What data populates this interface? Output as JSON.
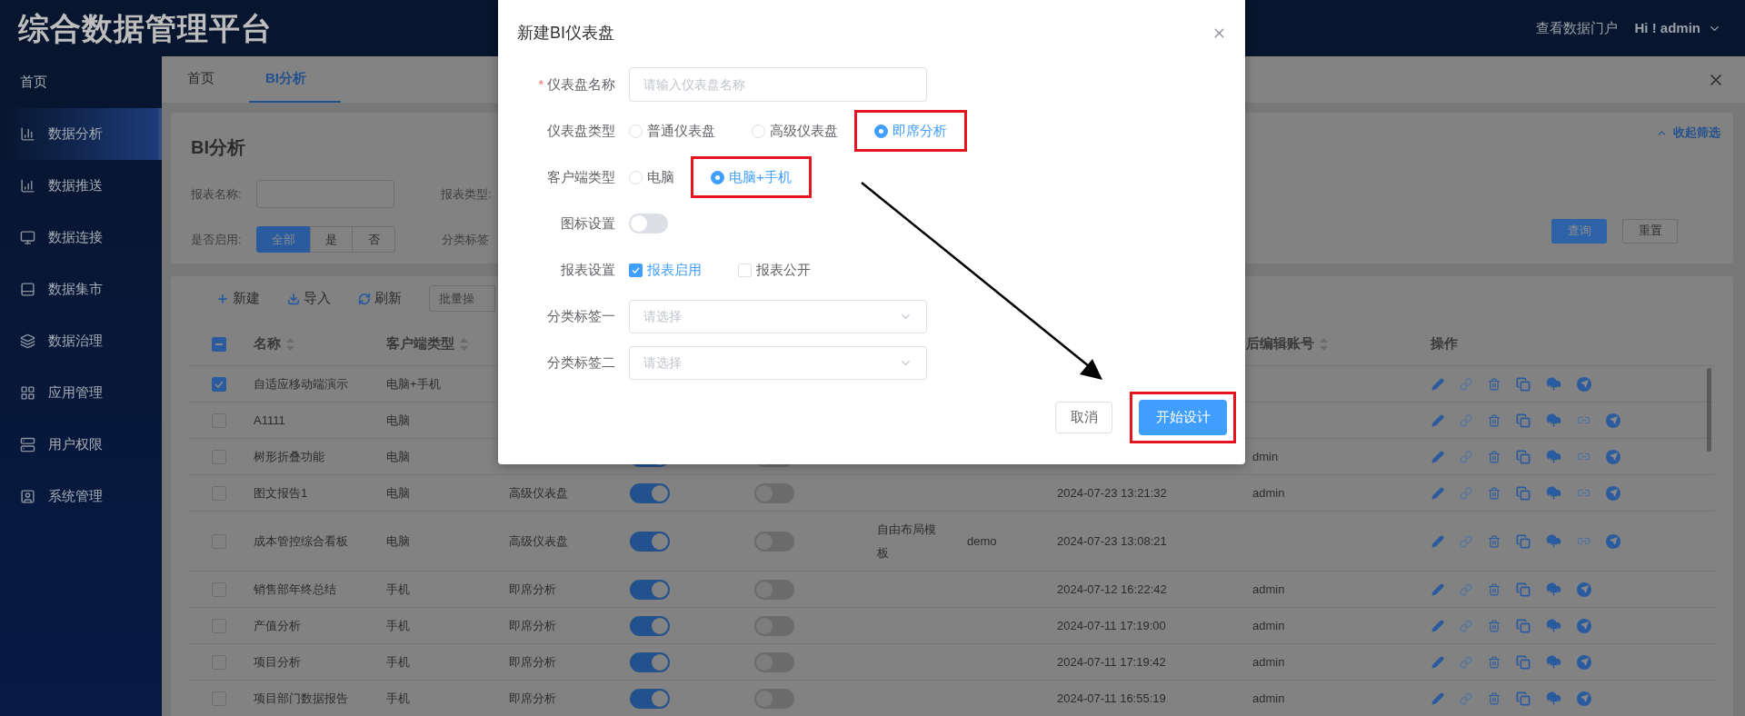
{
  "header": {
    "title": "综合数据管理平台",
    "portal_link": "查看数据门户",
    "user": "Hi ! admin"
  },
  "sidebar": {
    "items": [
      {
        "label": "首页",
        "selected": false
      },
      {
        "label": "数据分析",
        "selected": true
      },
      {
        "label": "数据推送",
        "selected": false
      },
      {
        "label": "数据连接",
        "selected": false
      },
      {
        "label": "数据集市",
        "selected": false
      },
      {
        "label": "数据治理",
        "selected": false
      },
      {
        "label": "应用管理",
        "selected": false
      },
      {
        "label": "用户权限",
        "selected": false
      },
      {
        "label": "系统管理",
        "selected": false
      }
    ]
  },
  "tabs": [
    {
      "label": "首页",
      "selected": false
    },
    {
      "label": "BI分析",
      "selected": true
    }
  ],
  "filter": {
    "title": "BI分析",
    "toggle": "收起筛选",
    "name_label": "报表名称:",
    "type_label": "报表类型:",
    "enabled_label": "是否启用:",
    "enabled_options": [
      {
        "label": "全部",
        "selected": true
      },
      {
        "label": "是",
        "selected": false
      },
      {
        "label": "否",
        "selected": false
      }
    ],
    "tag_label": "分类标签",
    "buttons": [
      {
        "label": "查询",
        "kind": "primary"
      },
      {
        "label": "重置",
        "kind": "default"
      }
    ]
  },
  "table": {
    "toolbar": [
      {
        "label": "新建",
        "kind": "new"
      },
      {
        "label": "导入",
        "kind": "import"
      },
      {
        "label": "刷新",
        "kind": "refresh"
      },
      {
        "label": "批量操",
        "kind": "batch"
      }
    ],
    "header_partial": true,
    "columns": {
      "name": {
        "label": "名称",
        "sortable": true
      },
      "client_type": {
        "label": "客户端类型",
        "sortable": true
      },
      "last_editor": {
        "label": "后编辑账号",
        "sortable": true
      },
      "actions": {
        "label": "操作",
        "sortable": false
      }
    },
    "rows": [
      {
        "selected": true,
        "name": "自适应移动端演示",
        "client_type": "电脑+手机",
        "extra_action": false
      },
      {
        "selected": false,
        "name": "A1111",
        "client_type": "电脑",
        "extra_action": true
      },
      {
        "selected": false,
        "name": "树形折叠功能",
        "client_type": "电脑",
        "enabled": true,
        "public": false,
        "last_editor": "dmin",
        "extra_action": true
      },
      {
        "selected": false,
        "name": "图文报告1",
        "client_type": "电脑",
        "dashboard_type": "高级仪表盘",
        "enabled": true,
        "public": false,
        "updated": "2024-07-23 13:21:32",
        "last_editor": "admin",
        "extra_action": true
      },
      {
        "selected": false,
        "name": "成本管控综合看板",
        "client_type": "电脑",
        "dashboard_type": "高级仪表盘",
        "enabled": true,
        "public": false,
        "template": "自由布局模板",
        "creator": "demo",
        "updated": "2024-07-23 13:08:21",
        "extra_action": true
      },
      {
        "selected": false,
        "name": "销售部年终总结",
        "client_type": "手机",
        "dashboard_type": "即席分析",
        "enabled": true,
        "public": false,
        "updated": "2024-07-12 16:22:42",
        "last_editor": "admin",
        "extra_action": false
      },
      {
        "selected": false,
        "name": "产值分析",
        "client_type": "手机",
        "dashboard_type": "即席分析",
        "enabled": true,
        "public": false,
        "updated": "2024-07-11 17:19:00",
        "last_editor": "admin",
        "extra_action": false
      },
      {
        "selected": false,
        "name": "项目分析",
        "client_type": "手机",
        "dashboard_type": "即席分析",
        "enabled": true,
        "public": false,
        "updated": "2024-07-11 17:19:42",
        "last_editor": "admin",
        "extra_action": false
      },
      {
        "selected": false,
        "name": "项目部门数据报告",
        "client_type": "手机",
        "dashboard_type": "即席分析",
        "enabled": true,
        "public": false,
        "updated": "2024-07-11 16:55:19",
        "last_editor": "admin",
        "extra_action": false
      }
    ]
  },
  "dialog": {
    "title": "新建BI仪表盘",
    "fields": [
      {
        "kind": "text",
        "label": "仪表盘名称",
        "required_mark": "*",
        "placeholder": "请输入仪表盘名称"
      },
      {
        "kind": "radio",
        "label": "仪表盘类型",
        "options": [
          {
            "label": "普通仪表盘",
            "selected": false,
            "highlighted": false
          },
          {
            "label": "高级仪表盘",
            "selected": false,
            "highlighted": false
          },
          {
            "label": "即席分析",
            "selected": true,
            "highlighted": true
          }
        ]
      },
      {
        "kind": "radio",
        "label": "客户端类型",
        "options": [
          {
            "label": "电脑",
            "selected": false,
            "highlighted": false
          },
          {
            "label": "电脑+手机",
            "selected": true,
            "highlighted": true
          }
        ]
      },
      {
        "kind": "switch",
        "label": "图标设置",
        "on": false
      },
      {
        "kind": "checkbox",
        "label": "报表设置",
        "options": [
          {
            "label": "报表启用",
            "checked": true
          },
          {
            "label": "报表公开",
            "checked": false
          }
        ]
      },
      {
        "kind": "select",
        "label": "分类标签一",
        "placeholder": "请选择"
      },
      {
        "kind": "select",
        "label": "分类标签二",
        "placeholder": "请选择"
      }
    ],
    "buttons": [
      {
        "label": "取消",
        "kind": "default",
        "highlighted": false
      },
      {
        "label": "开始设计",
        "kind": "primary",
        "highlighted": true
      }
    ]
  }
}
